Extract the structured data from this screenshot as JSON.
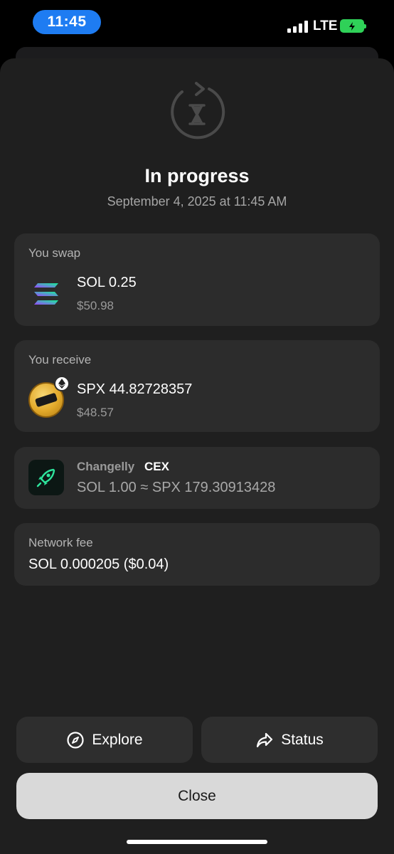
{
  "status_bar": {
    "time": "11:45",
    "network": "LTE",
    "battery_color": "#2fd158",
    "time_pill_color": "#1e7cf2"
  },
  "header": {
    "icon": "hourglass-refresh-icon",
    "title": "In progress",
    "date": "September 4, 2025 at 11:45 AM"
  },
  "swap": {
    "label": "You swap",
    "icon": "solana-logo-icon",
    "amount": "SOL 0.25",
    "usd": "$50.98"
  },
  "receive": {
    "label": "You receive",
    "icon": "spx6900-logo-icon",
    "badge_icon": "ethereum-badge-icon",
    "amount": "SPX 44.82728357",
    "usd": "$48.57"
  },
  "provider": {
    "icon": "changelly-rocket-icon",
    "name": "Changelly",
    "tag": "CEX",
    "rate": "SOL 1.00 ≈ SPX 179.30913428"
  },
  "fee": {
    "label": "Network fee",
    "value": "SOL 0.000205 ($0.04)"
  },
  "actions": {
    "explore_label": "Explore",
    "explore_icon": "compass-icon",
    "status_label": "Status",
    "status_icon": "share-arrow-icon",
    "close_label": "Close"
  }
}
